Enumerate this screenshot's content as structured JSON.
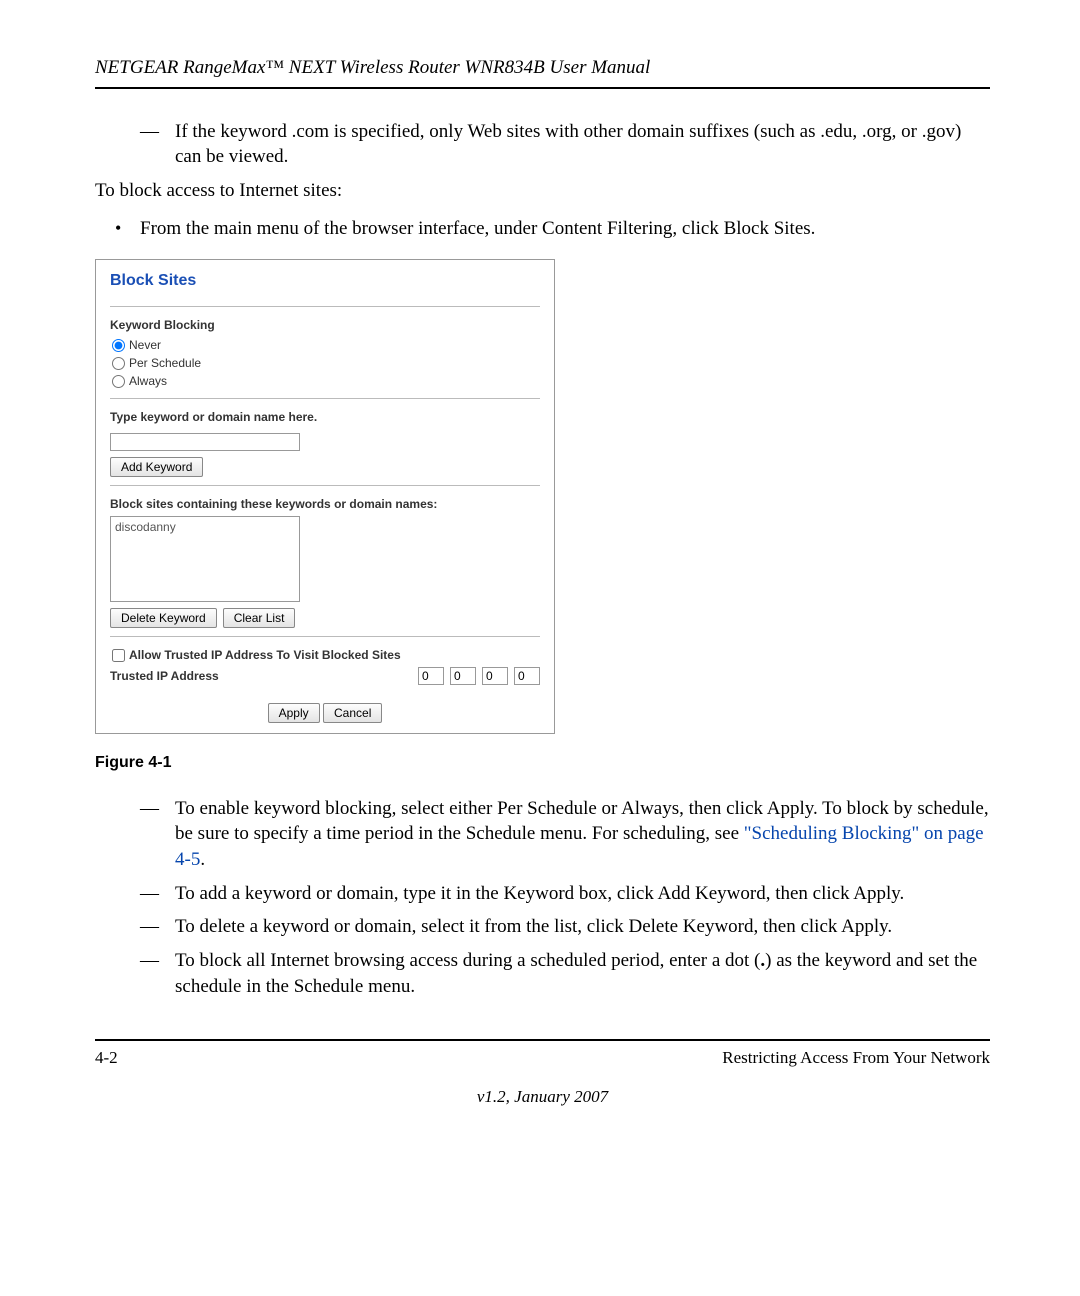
{
  "header": {
    "title": "NETGEAR RangeMax™ NEXT Wireless Router WNR834B User Manual"
  },
  "intro": {
    "dash1_text": "If the keyword .com is specified, only Web sites with other domain suffixes (such as .edu, .org, or .gov) can be viewed.",
    "lead": "To block access to Internet sites:",
    "bullet1": "From the main menu of the browser interface, under Content Filtering, click Block Sites."
  },
  "panel": {
    "title": "Block Sites",
    "keyword_blocking_label": "Keyword Blocking",
    "radio_never": "Never",
    "radio_per_schedule": "Per Schedule",
    "radio_always": "Always",
    "type_keyword_label": "Type keyword or domain name here.",
    "keyword_input_value": "",
    "add_keyword_btn": "Add Keyword",
    "block_list_label": "Block sites containing these keywords or domain names:",
    "block_list_items": [
      "discodanny"
    ],
    "delete_keyword_btn": "Delete Keyword",
    "clear_list_btn": "Clear List",
    "allow_trusted_label": "Allow Trusted IP Address To Visit Blocked Sites",
    "trusted_ip_label": "Trusted IP Address",
    "ip_octets": [
      "0",
      "0",
      "0",
      "0"
    ],
    "apply_btn": "Apply",
    "cancel_btn": "Cancel"
  },
  "figure_caption": "Figure 4-1",
  "post": {
    "item1_pre": "To enable keyword blocking, select either Per Schedule or Always, then click Apply. To block by schedule, be sure to specify a time period in the Schedule menu. For scheduling, see ",
    "item1_link": "\"Scheduling Blocking\" on page 4-5",
    "item1_post": ".",
    "item2": "To add a keyword or domain, type it in the Keyword box, click Add Keyword, then click Apply.",
    "item3": "To delete a keyword or domain, select it from the list, click Delete Keyword, then click Apply.",
    "item4_pre": "To block all Internet browsing access during a scheduled period, enter a dot (",
    "item4_bold": ".",
    "item4_post": ") as the keyword and set the schedule in the Schedule menu."
  },
  "footer": {
    "page_num": "4-2",
    "section": "Restricting Access From Your Network",
    "version": "v1.2, January 2007"
  }
}
